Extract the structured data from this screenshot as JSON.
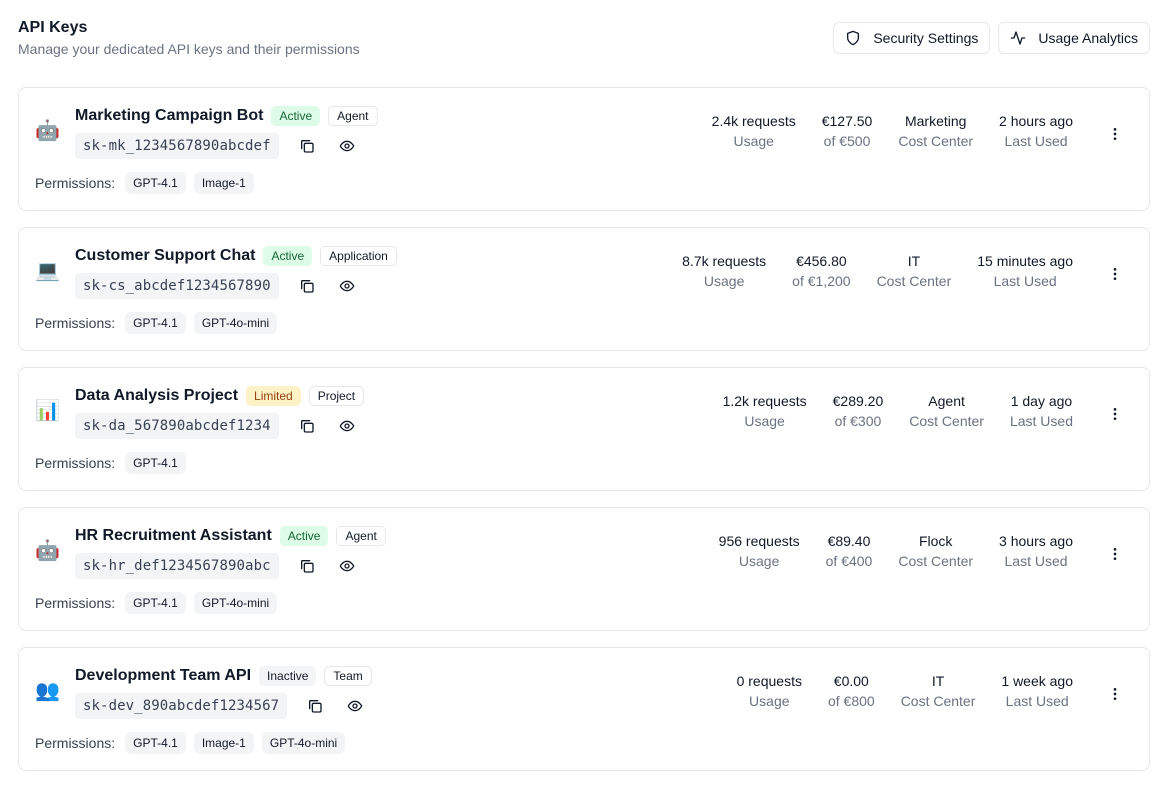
{
  "header": {
    "title": "API Keys",
    "subtitle": "Manage your dedicated API keys and their permissions",
    "security_label": "Security Settings",
    "analytics_label": "Usage Analytics"
  },
  "labels": {
    "permissions": "Permissions:"
  },
  "keys": [
    {
      "emoji": "🤖",
      "name": "Marketing Campaign Bot",
      "status": "Active",
      "type": "Agent",
      "key": "sk-mk_1234567890abcdef",
      "permissions": [
        "GPT-4.1",
        "Image-1"
      ],
      "usage": "2.4k requests",
      "usage_label": "Usage",
      "cost": "€127.50",
      "budget": "of €500",
      "cost_center": "Marketing",
      "cost_center_label": "Cost Center",
      "last_used": "2 hours ago",
      "last_used_label": "Last Used"
    },
    {
      "emoji": "💻",
      "name": "Customer Support Chat",
      "status": "Active",
      "type": "Application",
      "key": "sk-cs_abcdef1234567890",
      "permissions": [
        "GPT-4.1",
        "GPT-4o-mini"
      ],
      "usage": "8.7k requests",
      "usage_label": "Usage",
      "cost": "€456.80",
      "budget": "of €1,200",
      "cost_center": "IT",
      "cost_center_label": "Cost Center",
      "last_used": "15 minutes ago",
      "last_used_label": "Last Used"
    },
    {
      "emoji": "📊",
      "name": "Data Analysis Project",
      "status": "Limited",
      "type": "Project",
      "key": "sk-da_567890abcdef1234",
      "permissions": [
        "GPT-4.1"
      ],
      "usage": "1.2k requests",
      "usage_label": "Usage",
      "cost": "€289.20",
      "budget": "of €300",
      "cost_center": "Agent",
      "cost_center_label": "Cost Center",
      "last_used": "1 day ago",
      "last_used_label": "Last Used"
    },
    {
      "emoji": "🤖",
      "name": "HR Recruitment Assistant",
      "status": "Active",
      "type": "Agent",
      "key": "sk-hr_def1234567890abc",
      "permissions": [
        "GPT-4.1",
        "GPT-4o-mini"
      ],
      "usage": "956 requests",
      "usage_label": "Usage",
      "cost": "€89.40",
      "budget": "of €400",
      "cost_center": "Flock",
      "cost_center_label": "Cost Center",
      "last_used": "3 hours ago",
      "last_used_label": "Last Used"
    },
    {
      "emoji": "👥",
      "name": "Development Team API",
      "status": "Inactive",
      "type": "Team",
      "key": "sk-dev_890abcdef1234567",
      "permissions": [
        "GPT-4.1",
        "Image-1",
        "GPT-4o-mini"
      ],
      "usage": "0 requests",
      "usage_label": "Usage",
      "cost": "€0.00",
      "budget": "of €800",
      "cost_center": "IT",
      "cost_center_label": "Cost Center",
      "last_used": "1 week ago",
      "last_used_label": "Last Used"
    }
  ],
  "icons": {
    "security": "shield-icon",
    "analytics": "activity-icon",
    "copy": "copy-icon",
    "reveal": "eye-icon",
    "more": "more-vertical-icon"
  },
  "colors": {
    "active_bg": "#dcfce7",
    "active_text": "#166534",
    "limited_bg": "#fef3c7",
    "limited_text": "#92400e",
    "inactive_bg": "#f3f4f6"
  }
}
